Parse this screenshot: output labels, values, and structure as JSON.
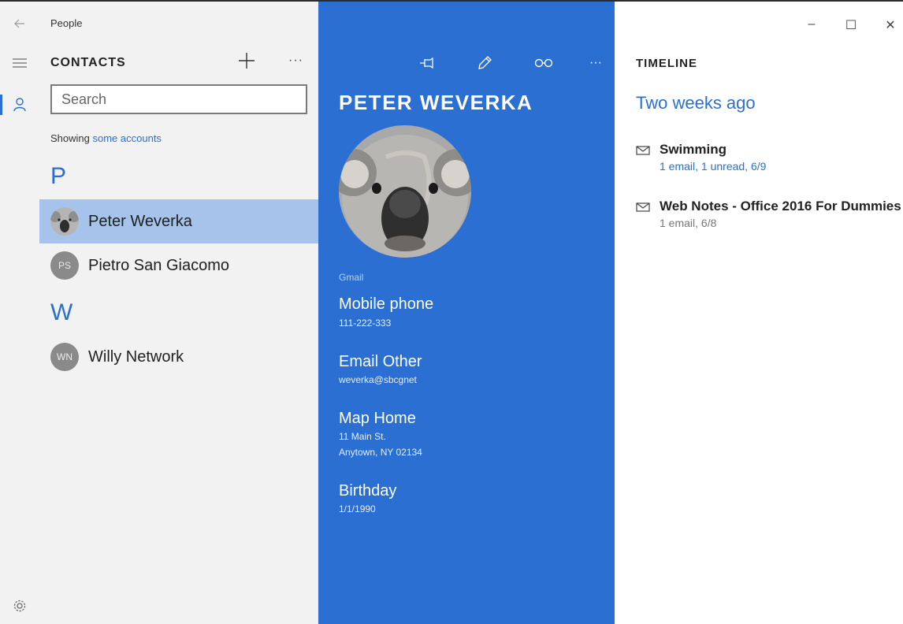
{
  "app": {
    "title": "People"
  },
  "rail": {
    "back_icon": "back-arrow-icon",
    "menu_icon": "hamburger-menu-icon",
    "contacts_icon": "person-icon",
    "settings_icon": "gear-icon"
  },
  "contacts": {
    "heading": "CONTACTS",
    "add_label": "+",
    "more_label": "···",
    "search_placeholder": "Search",
    "showing_prefix": "Showing",
    "showing_link": "some accounts",
    "groups": [
      {
        "letter": "P",
        "items": [
          {
            "name": "Peter Weverka",
            "initials": "",
            "selected": true
          },
          {
            "name": "Pietro San Giacomo",
            "initials": "PS",
            "selected": false
          }
        ]
      },
      {
        "letter": "W",
        "items": [
          {
            "name": "Willy Network",
            "initials": "WN",
            "selected": false
          }
        ]
      }
    ]
  },
  "detail": {
    "toolbar": {
      "pin_icon": "pin-icon",
      "edit_icon": "pencil-icon",
      "link_icon": "link-icon",
      "more_label": "···"
    },
    "name": "PETER WEVERKA",
    "source": "Gmail",
    "fields": [
      {
        "label": "Mobile phone",
        "values": [
          "111-222-333"
        ]
      },
      {
        "label": "Email Other",
        "values": [
          "weverka@sbcgnet"
        ]
      },
      {
        "label": "Map Home",
        "values": [
          "11 Main St.",
          "Anytown, NY 02134"
        ]
      },
      {
        "label": "Birthday",
        "values": [
          "1/1/1990"
        ]
      }
    ]
  },
  "timeline": {
    "heading": "TIMELINE",
    "when": "Two weeks ago",
    "items": [
      {
        "title": "Swimming",
        "subtitle": "1 email, 1 unread, 6/9",
        "unread": true
      },
      {
        "title": "Web Notes - Office 2016 For Dummies",
        "subtitle": "1 email, 6/8",
        "unread": false
      }
    ]
  },
  "window_controls": {
    "minimize": "–",
    "maximize": "☐",
    "close": "✕"
  },
  "colors": {
    "accent": "#2a6fd1",
    "selected_row": "#a6c3ec",
    "pane_bg": "#f2f2f2"
  }
}
